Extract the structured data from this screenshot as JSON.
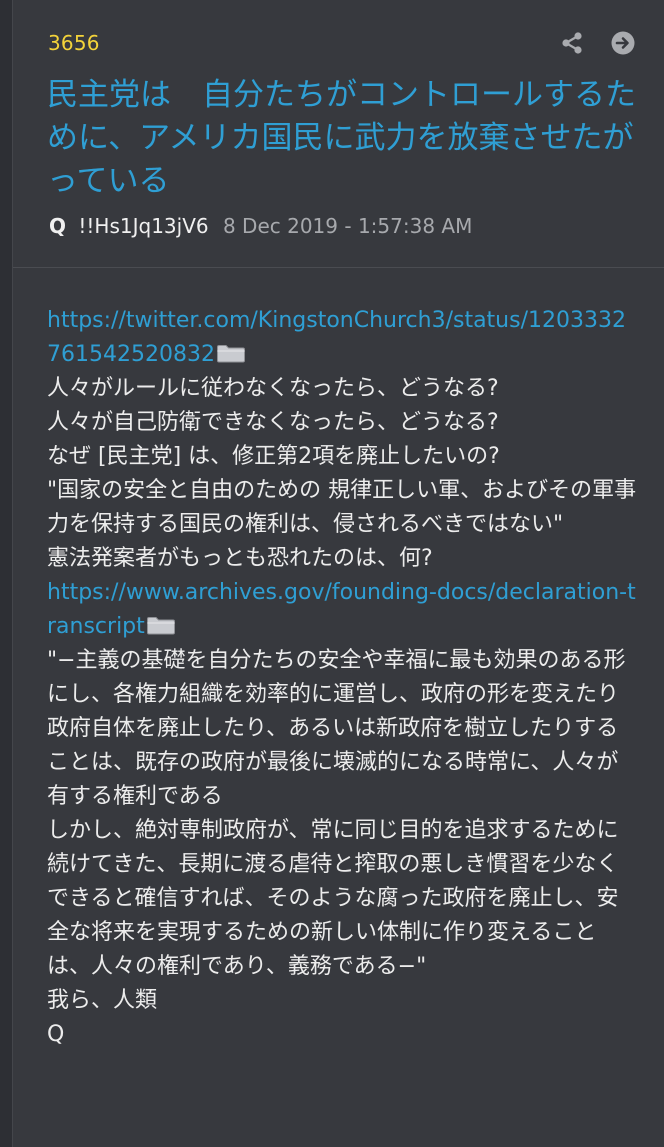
{
  "post": {
    "number": "3656",
    "title": "民主党は　自分たちがコントロールするために、アメリカ国民に武力を放棄させたがっている",
    "author": "Q",
    "tripcode": "!!Hs1Jq13jV6",
    "timestamp": "8 Dec 2019 - 1:57:38 AM"
  },
  "icons": {
    "share": "share-icon",
    "forward": "arrow-right-circle-icon",
    "folder": "folder-icon"
  },
  "colors": {
    "post_number": "#f3d33a",
    "title_link": "#2f9fd4",
    "background": "#37393e"
  },
  "body": {
    "link1": "https://twitter.com/KingstonChurch3/status/1203332761542520832",
    "lines_a": [
      "人々がルールに従わなくなったら、どうなる?",
      "人々が自己防衛できなくなったら、どうなる?",
      "なぜ [民主党] は、修正第2項を廃止したいの?",
      "\"国家の安全と自由のための 規律正しい軍、およびその軍事力を保持する国民の権利は、侵されるべきではない\"",
      "憲法発案者がもっとも恐れたのは、何?"
    ],
    "link2": "https://www.archives.gov/founding-docs/declaration-transcript",
    "lines_b": [
      "\"−主義の基礎を自分たちの安全や幸福に最も効果のある形にし、各権力組織を効率的に運営し、政府の形を変えたり政府自体を廃止したり、あるいは新政府を樹立したりすることは、既存の政府が最後に壊滅的になる時常に、人々が有する権利である",
      "しかし、絶対専制政府が、常に同じ目的を追求するために続けてきた、長期に渡る虐待と搾取の悪しき慣習を少なくできると確信すれば、そのような腐った政府を廃止し、安全な将来を実現するための新しい体制に作り変えることは、人々の権利であり、義務である−\"",
      "我ら、人類",
      "Q"
    ]
  }
}
